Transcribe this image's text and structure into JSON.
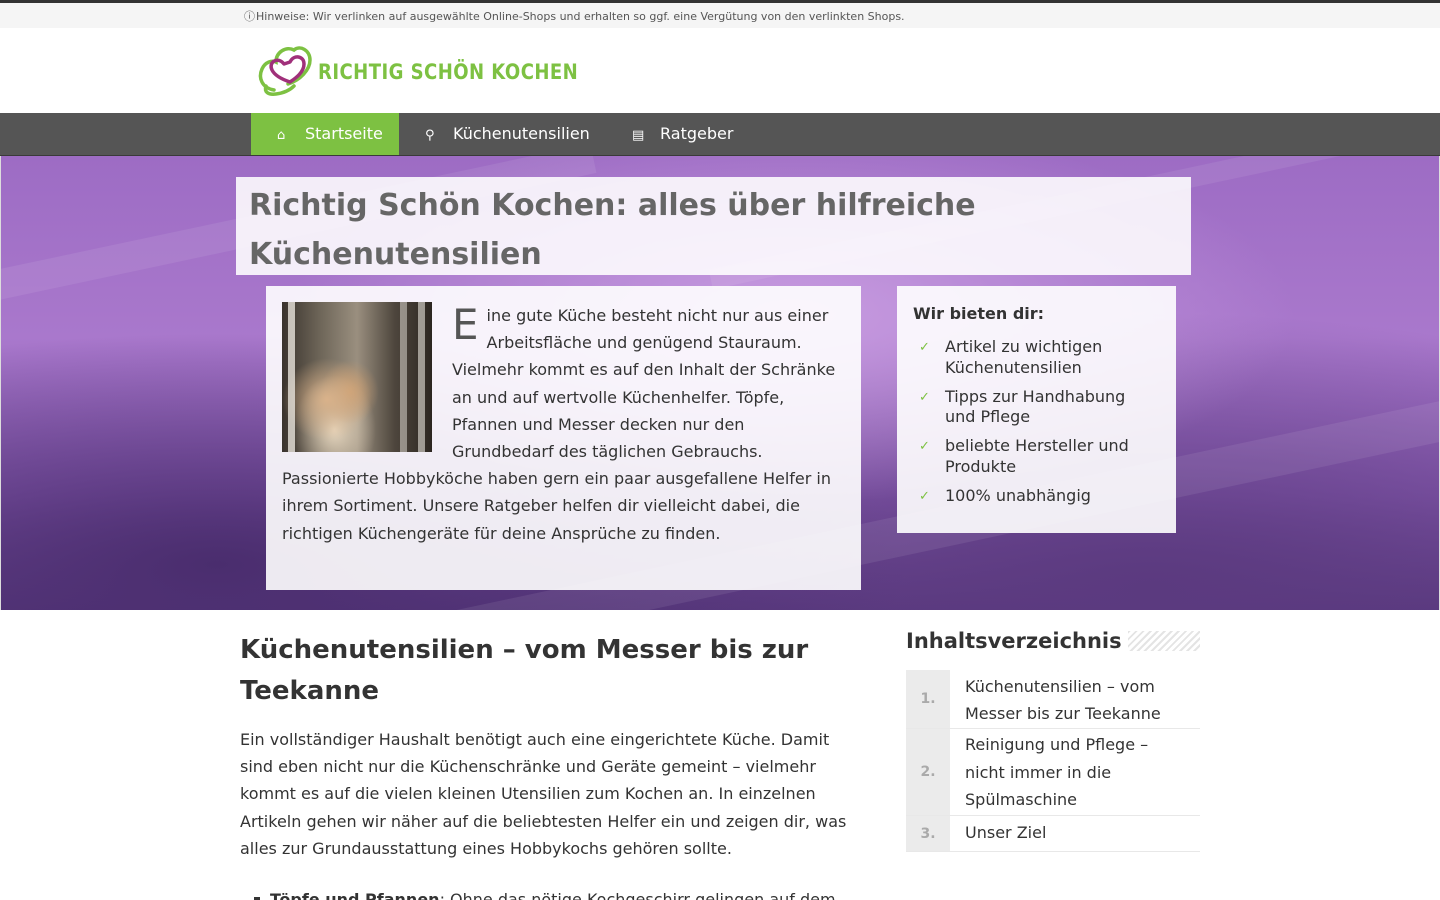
{
  "topbar": {
    "note_icon": "info-icon",
    "note": "Hinweise: Wir verlinken auf ausgewählte Online-Shops und erhalten so ggf. eine Vergütung von den verlinkten Shops."
  },
  "header": {
    "logo_text": "RICHTIG SCHÖN KOCHEN",
    "logo_icon": "heart-chef-hat-icon"
  },
  "nav": {
    "items": [
      {
        "label": "Startseite",
        "icon": "home-icon",
        "active": true
      },
      {
        "label": "Küchenutensilien",
        "icon": "utensils-icon",
        "active": false
      },
      {
        "label": "Ratgeber",
        "icon": "book-icon",
        "active": false
      }
    ]
  },
  "hero": {
    "title": "Richtig Schön Kochen: alles über hilfreiche Küchenutensilien",
    "intro_dropcap": "E",
    "intro_text": "ine gute Küche besteht nicht nur aus einer Arbeitsfläche und genügend Stauraum. Vielmehr kommt es auf den Inhalt der Schränke an und auf wertvolle Küchenhelfer. Töpfe, Pfannen und Messer decken nur den Grundbedarf des täglichen Gebrauchs. Passionierte Hobbyköche haben gern ein paar ausgefallene Helfer in ihrem Sortiment. Unsere Ratgeber helfen dir vielleicht dabei, die richtigen Küchengeräte für deine Ansprüche zu finden.",
    "offer_title": "Wir bieten dir:",
    "offer_items": [
      "Artikel zu wichtigen Küchenutensilien",
      "Tipps zur Handhabung und Pflege",
      "beliebte Hersteller und Produkte",
      "100% unabhängig"
    ],
    "offer_icon": "check-icon"
  },
  "main": {
    "heading": "Küchenutensilien – vom Messer bis zur Teekanne",
    "paragraph": "Ein vollständiger Haushalt benötigt auch eine eingerichtete Küche. Damit sind eben nicht nur die Küchenschränke und Geräte gemeint – vielmehr kommt es auf die vielen kleinen Utensilien zum Kochen an. In einzelnen Artikeln gehen wir näher auf die beliebtesten Helfer ein und zeigen dir, was alles zur Grundausstattung eines Hobbykochs gehören sollte.",
    "list": [
      {
        "bold": "Töpfe und Pfannen",
        "text": ": Ohne das nötige Kochgeschirr gelingen auf dem"
      }
    ]
  },
  "sidebar": {
    "title": "Inhaltsverzeichnis",
    "toc": [
      {
        "num": "1.",
        "label": "Küchenutensilien – vom Messer bis zur Teekanne"
      },
      {
        "num": "2.",
        "label": "Reinigung und Pflege – nicht immer in die Spülmaschine"
      },
      {
        "num": "3.",
        "label": "Unser Ziel"
      }
    ]
  },
  "colors": {
    "accent": "#7dc142",
    "logo_heart": "#a0307a",
    "nav_bg": "#555555"
  }
}
